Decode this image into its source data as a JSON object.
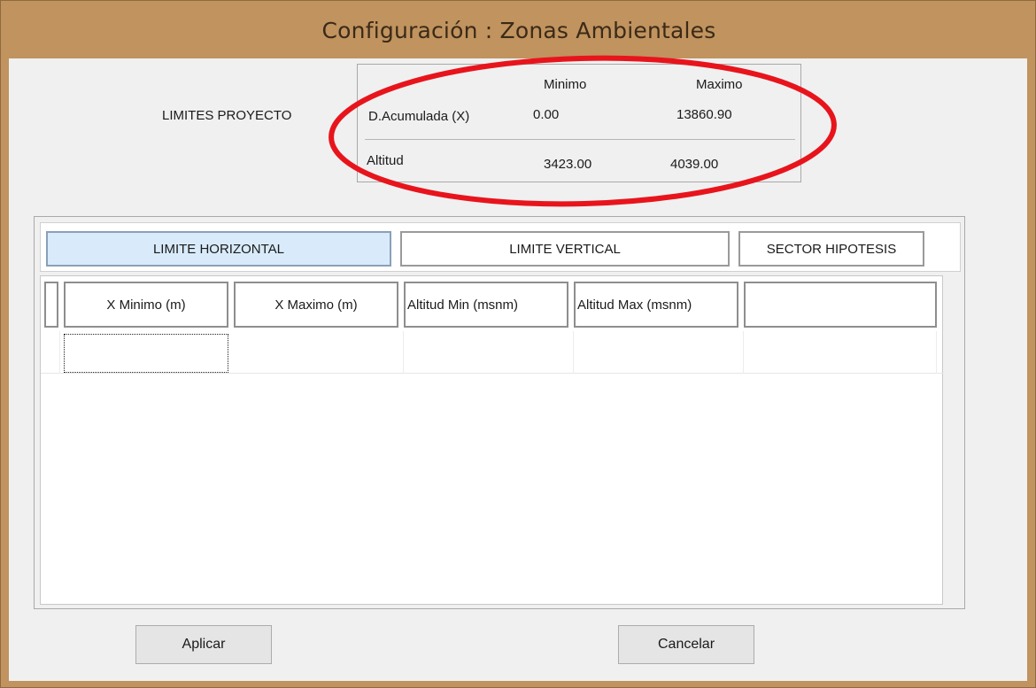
{
  "window": {
    "title": "Configuración : Zonas Ambientales"
  },
  "summary": {
    "label": "LIMITES PROYECTO",
    "col_min": "Minimo",
    "col_max": "Maximo",
    "rows": [
      {
        "name": "D.Acumulada (X)",
        "min": "0.00",
        "max": "13860.90"
      },
      {
        "name": "Altitud",
        "min": "3423.00",
        "max": "4039.00"
      }
    ],
    "highlight_color": "#e8141c"
  },
  "tabs": [
    {
      "label": "LIMITE HORIZONTAL"
    },
    {
      "label": "LIMITE VERTICAL"
    },
    {
      "label": "SECTOR HIPOTESIS"
    }
  ],
  "grid": {
    "columns": [
      "X Minimo (m)",
      "X Maximo  (m)",
      "Altitud Min  (msnm)",
      "Altitud Max (msnm)",
      ""
    ]
  },
  "buttons": {
    "apply": "Aplicar",
    "cancel": "Cancelar"
  },
  "colors": {
    "frame": "#c0935f",
    "active_tab": "#d9ebfb"
  }
}
